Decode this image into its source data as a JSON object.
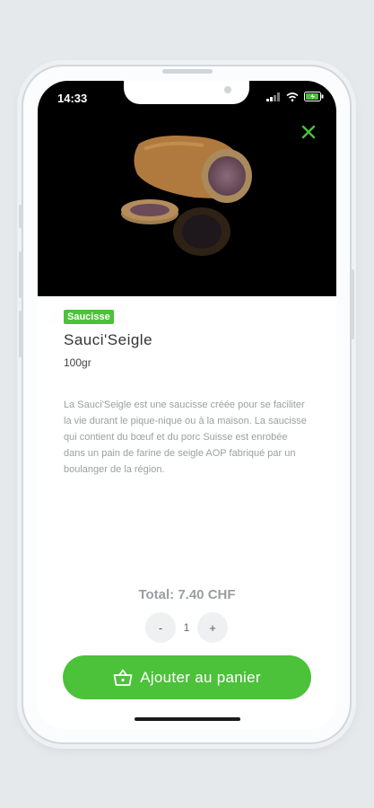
{
  "status_bar": {
    "time": "14:33"
  },
  "product": {
    "category": "Saucisse",
    "name": "Sauci'Seigle",
    "weight": "100gr",
    "description": "La Sauci'Seigle est une saucisse créée pour se faciliter la vie durant le pique-nique ou à la maison. La saucisse qui contient du bœuf et du porc Suisse est enrobée dans un pain de farine de seigle AOP fabriqué par un boulanger de la région."
  },
  "cart": {
    "total_label": "Total: 7.40 CHF",
    "minus_label": "-",
    "quantity": "1",
    "plus_label": "+",
    "add_label": "Ajouter au panier"
  },
  "colors": {
    "accent": "#4cc13a",
    "hero_bg": "#000000"
  },
  "icons": [
    "close-icon",
    "basket-icon",
    "signal-icon",
    "wifi-icon",
    "battery-icon"
  ]
}
